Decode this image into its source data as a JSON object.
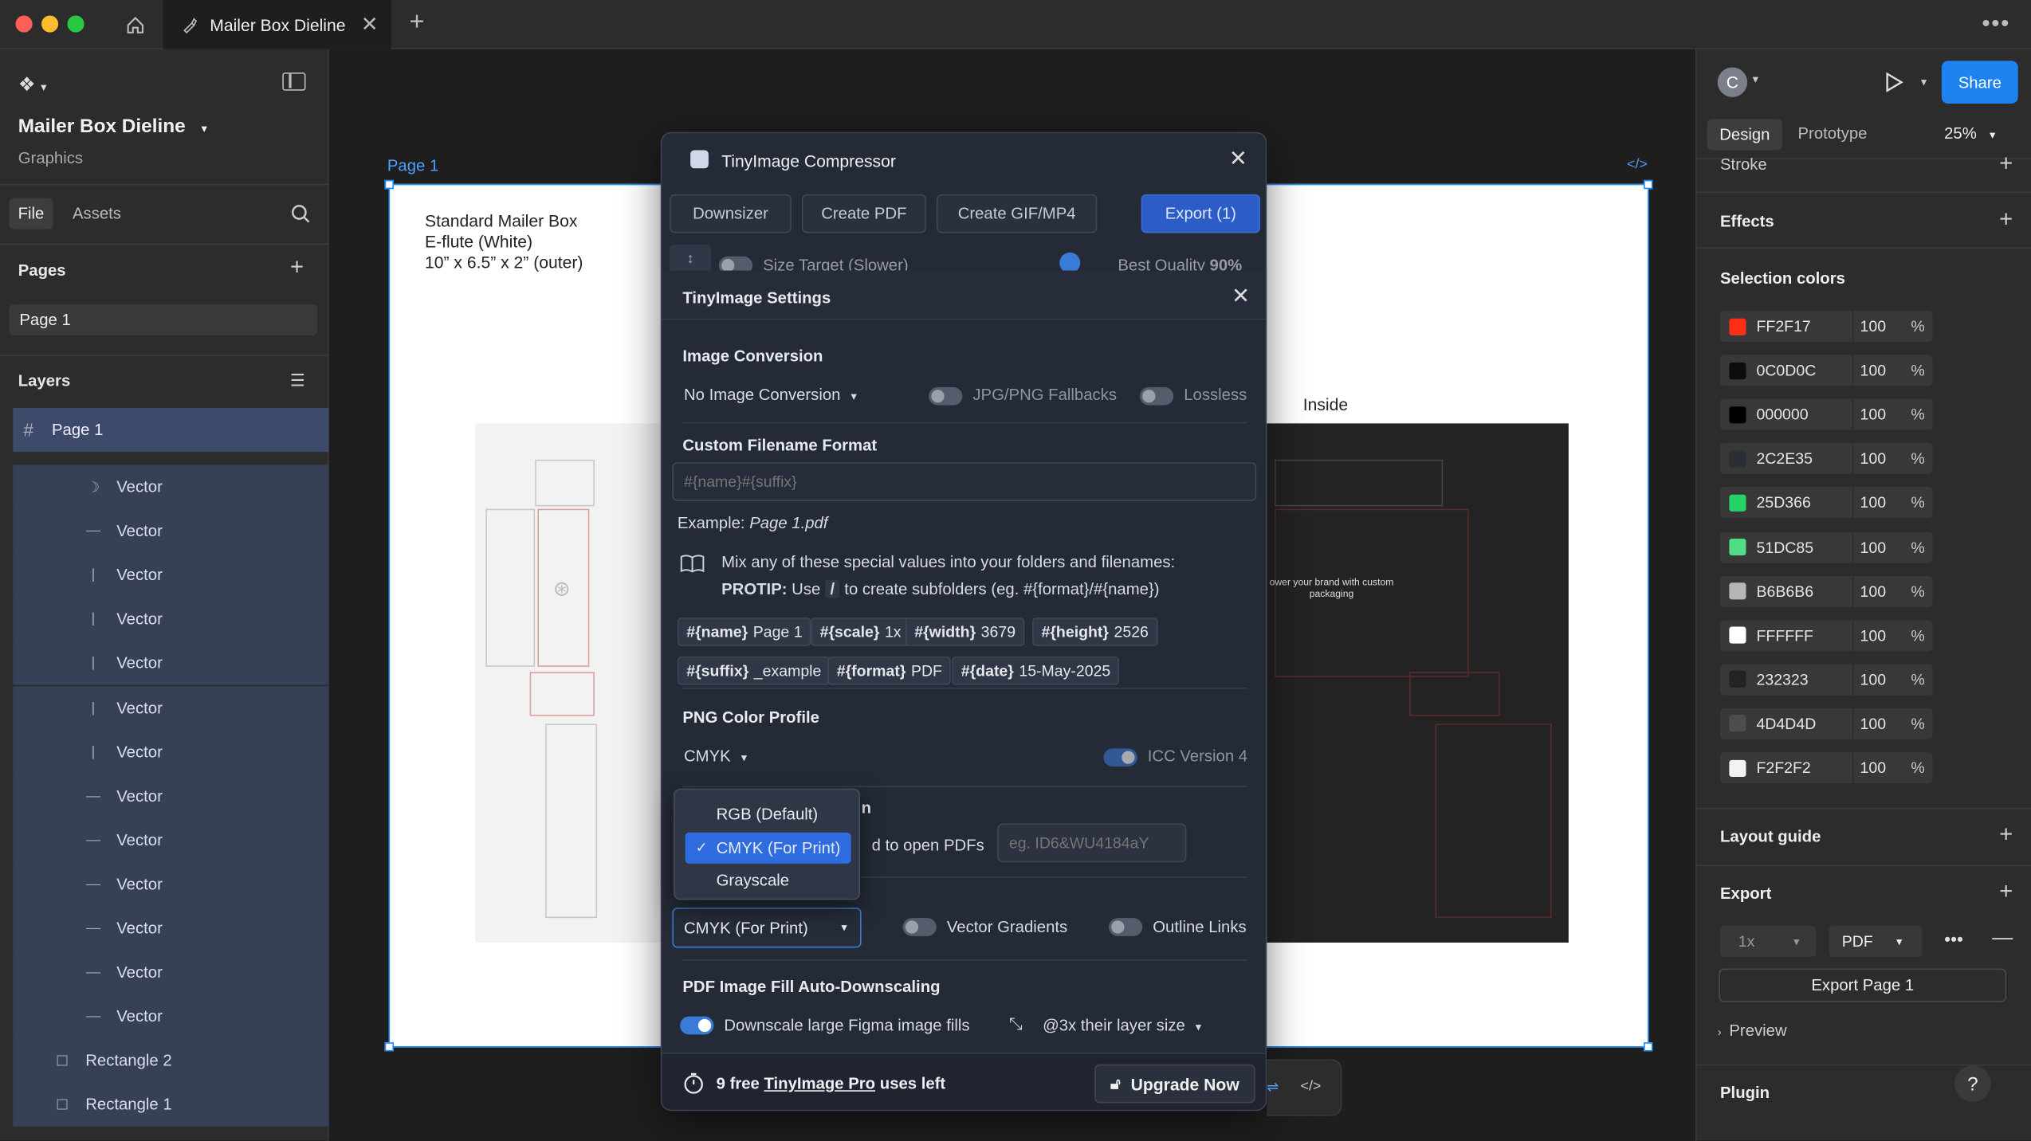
{
  "titlebar": {
    "tab_title": "Mailer Box Dieline"
  },
  "leftpanel": {
    "file_name": "Mailer Box Dieline",
    "file_subtitle": "Graphics",
    "tabs": [
      "File",
      "Assets"
    ],
    "pages_label": "Pages",
    "pages": [
      "Page 1"
    ],
    "layers_label": "Layers",
    "root_layer": "Page 1",
    "layers": [
      {
        "icon": "☽",
        "name": "Vector"
      },
      {
        "icon": "—",
        "name": "Vector"
      },
      {
        "icon": "|",
        "name": "Vector"
      },
      {
        "icon": "|",
        "name": "Vector"
      },
      {
        "icon": "|",
        "name": "Vector"
      },
      {
        "icon": "|",
        "name": "Vector"
      },
      {
        "icon": "|",
        "name": "Vector"
      },
      {
        "icon": "—",
        "name": "Vector"
      },
      {
        "icon": "—",
        "name": "Vector"
      },
      {
        "icon": "—",
        "name": "Vector"
      },
      {
        "icon": "—",
        "name": "Vector"
      },
      {
        "icon": "—",
        "name": "Vector"
      },
      {
        "icon": "—",
        "name": "Vector"
      },
      {
        "icon": "☐",
        "name": "Rectangle 2"
      },
      {
        "icon": "☐",
        "name": "Rectangle 1"
      }
    ]
  },
  "canvas": {
    "frame_label": "Page 1",
    "spec_line1": "Standard Mailer Box",
    "spec_line2": "E-flute (White)",
    "spec_line3": "10” x 6.5” x 2” (outer)",
    "inside_label": "Inside",
    "brand_text": "ower your brand with custom packaging"
  },
  "rightpanel": {
    "avatar_letter": "C",
    "share_label": "Share",
    "tabs": [
      "Design",
      "Prototype"
    ],
    "zoom": "25%",
    "stroke_label": "Stroke",
    "effects_label": "Effects",
    "selection_colors_label": "Selection colors",
    "colors": [
      {
        "hex": "FF2F17",
        "swatch": "#FF2F17",
        "opacity": "100"
      },
      {
        "hex": "0C0D0C",
        "swatch": "#0C0D0C",
        "opacity": "100"
      },
      {
        "hex": "000000",
        "swatch": "#000000",
        "opacity": "100"
      },
      {
        "hex": "2C2E35",
        "swatch": "#2C2E35",
        "opacity": "100"
      },
      {
        "hex": "25D366",
        "swatch": "#25D366",
        "opacity": "100"
      },
      {
        "hex": "51DC85",
        "swatch": "#51DC85",
        "opacity": "100"
      },
      {
        "hex": "B6B6B6",
        "swatch": "#B6B6B6",
        "opacity": "100"
      },
      {
        "hex": "FFFFFF",
        "swatch": "#FFFFFF",
        "opacity": "100"
      },
      {
        "hex": "232323",
        "swatch": "#232323",
        "opacity": "100"
      },
      {
        "hex": "4D4D4D",
        "swatch": "#4D4D4D",
        "opacity": "100"
      },
      {
        "hex": "F2F2F2",
        "swatch": "#F2F2F2",
        "opacity": "100"
      }
    ],
    "percent": "%",
    "layout_guide_label": "Layout guide",
    "export_label": "Export",
    "export_scale": "1x",
    "export_format": "PDF",
    "export_button": "Export Page 1",
    "preview_label": "Preview",
    "plugin_label": "Plugin",
    "help": "?"
  },
  "plugin": {
    "title": "TinyImage Compressor",
    "toolbar": [
      "Downsizer",
      "Create PDF",
      "Create GIF/MP4",
      "Export (1)"
    ],
    "behind_row": {
      "size_target": "Size Target (Slower)",
      "best_quality": "Best Quality",
      "quality_value": "90%"
    },
    "settings_title": "TinyImage Settings",
    "image_conversion": {
      "heading": "Image Conversion",
      "selected": "No Image Conversion",
      "fallbacks": "JPG/PNG Fallbacks",
      "lossless": "Lossless"
    },
    "filename": {
      "heading": "Custom Filename Format",
      "placeholder": "#{name}#{suffix}",
      "example_prefix": "Example:",
      "example_value": "Page 1.pdf",
      "info_line1": "Mix any of these special values into your folders and filenames:",
      "protip_label": "PROTIP:",
      "protip_use": "Use",
      "protip_slash": "/",
      "protip_rest": "to create subfolders (eg. #{format}/#{name})",
      "chips": [
        {
          "key": "#{name}",
          "value": "Page 1"
        },
        {
          "key": "#{scale}",
          "value": "1x"
        },
        {
          "key": "#{width}",
          "value": "3679"
        },
        {
          "key": "#{height}",
          "value": "2526"
        },
        {
          "key": "#{suffix}",
          "value": "_example"
        },
        {
          "key": "#{format}",
          "value": "PDF"
        },
        {
          "key": "#{date}",
          "value": "15-May-2025"
        }
      ]
    },
    "png_profile": {
      "heading": "PNG Color Profile",
      "selected": "CMYK",
      "icc": "ICC Version 4"
    },
    "pdf_password": {
      "heading_tail": "n",
      "label_tail": "d to open PDFs",
      "placeholder": "eg. ID6&WU4184aY"
    },
    "dropdown": {
      "options": [
        "RGB (Default)",
        "CMYK (For Print)",
        "Grayscale"
      ],
      "selected_index": 1,
      "check": "✓"
    },
    "pdf_color": {
      "selected": "CMYK (For Print)",
      "vector_gradients": "Vector Gradients",
      "outline_links": "Outline Links"
    },
    "downscaling": {
      "heading": "PDF Image Fill Auto-Downscaling",
      "label": "Downscale large Figma image fills",
      "size": "@3x their layer size"
    },
    "footer": {
      "count_text": "9 free",
      "pro_link": "TinyImage Pro",
      "tail": "uses left",
      "upgrade": "Upgrade Now"
    }
  }
}
